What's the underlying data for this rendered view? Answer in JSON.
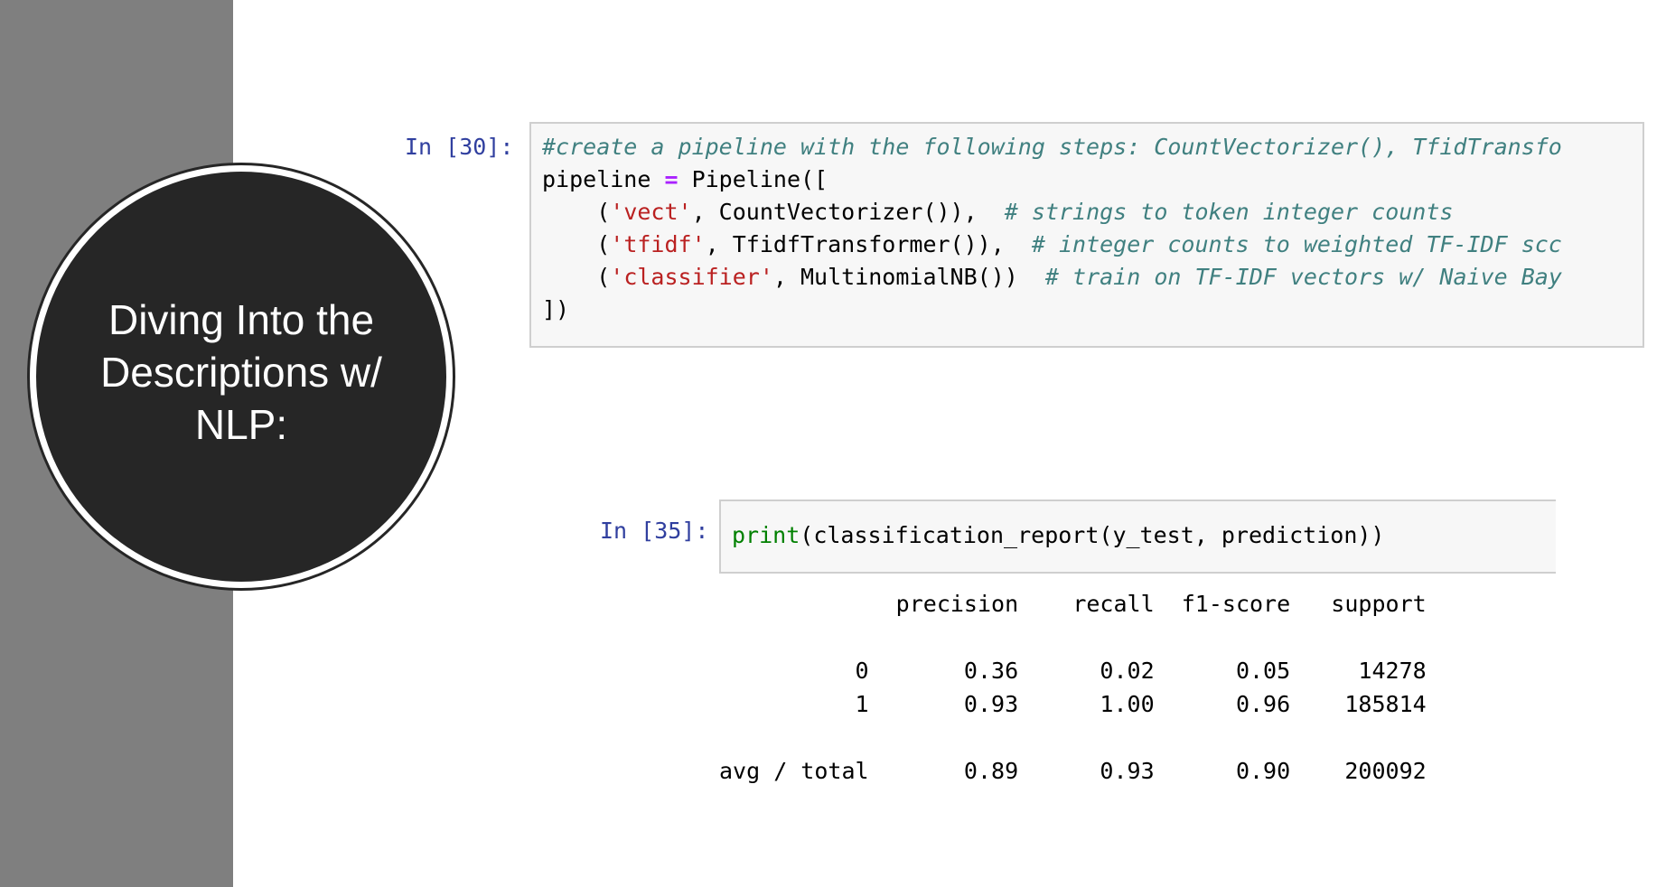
{
  "slide": {
    "title": "Diving Into the Descriptions w/ NLP:"
  },
  "cell_30": {
    "prompt": "In [30]:",
    "comment_line": "#create a pipeline with the following steps: CountVectorizer(), TfidTransfo",
    "line2_a": "pipeline ",
    "line2_op": "=",
    "line2_b": " Pipeline([",
    "vect_indent": "    (",
    "vect_str": "'vect'",
    "vect_code": ", CountVectorizer()),  ",
    "vect_comment": "# strings to token integer counts",
    "tfidf_indent": "    (",
    "tfidf_str": "'tfidf'",
    "tfidf_code": ", TfidfTransformer()),  ",
    "tfidf_comment": "# integer counts to weighted TF-IDF scc",
    "clf_indent": "    (",
    "clf_str": "'classifier'",
    "clf_code": ", MultinomialNB())  ",
    "clf_comment": "# train on TF-IDF vectors w/ Naive Bay",
    "closing": "])"
  },
  "cell_35": {
    "prompt": "In [35]:",
    "func": "print",
    "args": "(classification_report(y_test, prediction))"
  },
  "report": {
    "header": "             precision    recall  f1-score   support",
    "blank1": "",
    "row0": "          0       0.36      0.02      0.05     14278",
    "row1": "          1       0.93      1.00      0.96    185814",
    "blank2": "",
    "avg": "avg / total       0.89      0.93      0.90    200092"
  },
  "colors": {
    "sidebar": "#7f7f7f",
    "circle": "#262626",
    "prompt": "#303f9f",
    "comment": "#408080",
    "string": "#ba2121",
    "operator": "#aa22ff",
    "builtin": "#008000"
  }
}
